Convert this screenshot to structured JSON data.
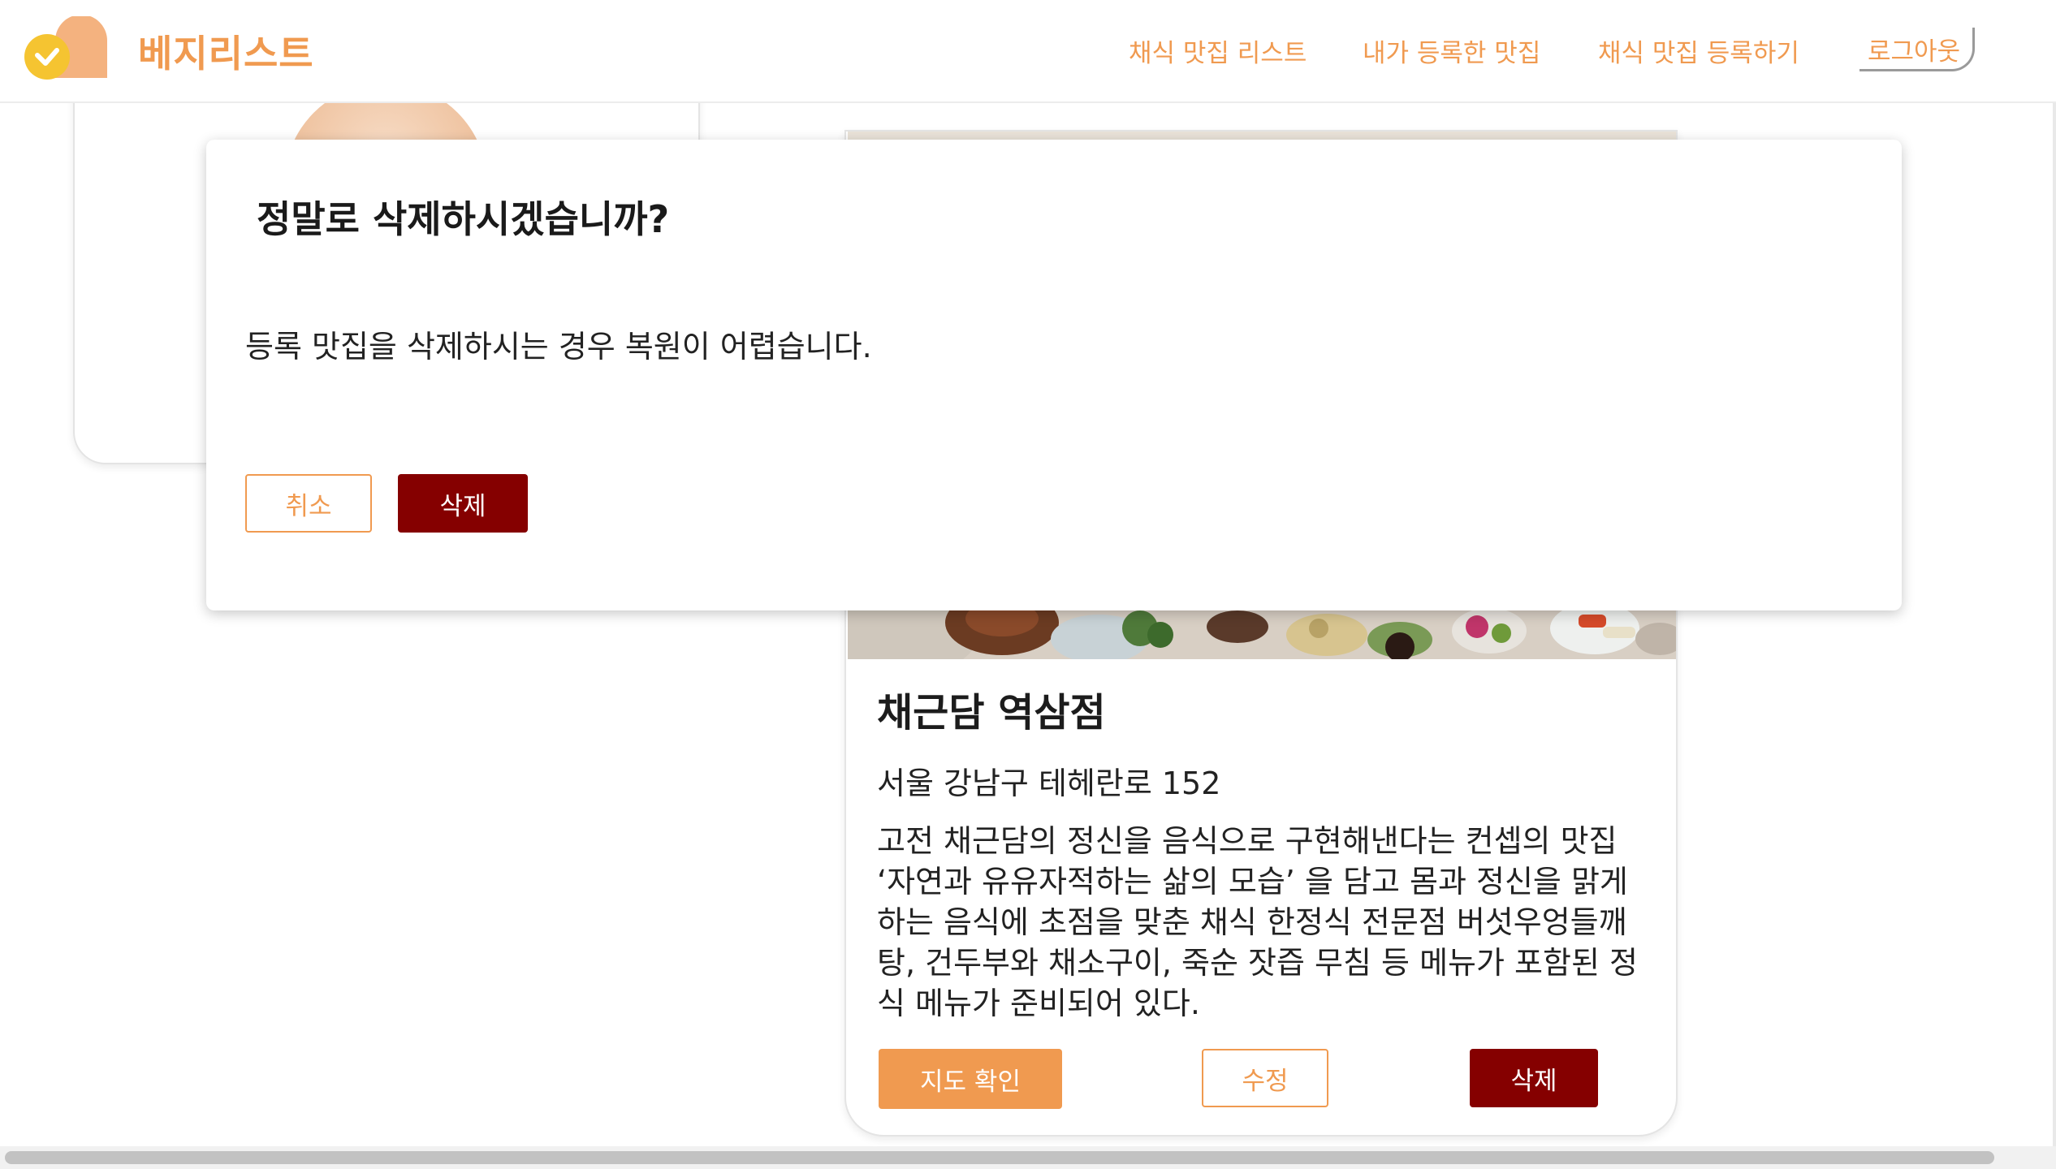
{
  "header": {
    "brand": "베지리스트",
    "nav": [
      {
        "label": "채식 맛집 리스트"
      },
      {
        "label": "내가 등록한 맛집"
      },
      {
        "label": "채식 맛집 등록하기"
      }
    ],
    "logout_label": "로그아웃"
  },
  "restaurant": {
    "name": "채근담 역삼점",
    "address": "서울 강남구 테헤란로 152",
    "description": "고전 채근담의 정신을 음식으로 구현해낸다는 컨셉의 맛집 ‘자연과 유유자적하는 삶의 모습’ 을 담고 몸과 정신을 맑게 하는 음식에 초점을 맞춘 채식 한정식 전문점 버섯우엉들깨탕, 건두부와 채소구이, 죽순 잣즙 무침 등 메뉴가 포함된 정식 메뉴가 준비되어 있다.",
    "map_button": "지도 확인",
    "edit_button": "수정",
    "delete_button": "삭제"
  },
  "modal": {
    "title": "정말로 삭제하시겠습니까?",
    "message": "등록 맛집을 삭제하시는 경우 복원이 어렵습니다.",
    "cancel_button": "취소",
    "delete_button": "삭제"
  },
  "colors": {
    "accent": "#f09a50",
    "danger": "#850000",
    "logo_yellow": "#f5c431",
    "logo_peach": "#f4b27f"
  },
  "icons": {
    "logo": "check-circle-icon"
  }
}
